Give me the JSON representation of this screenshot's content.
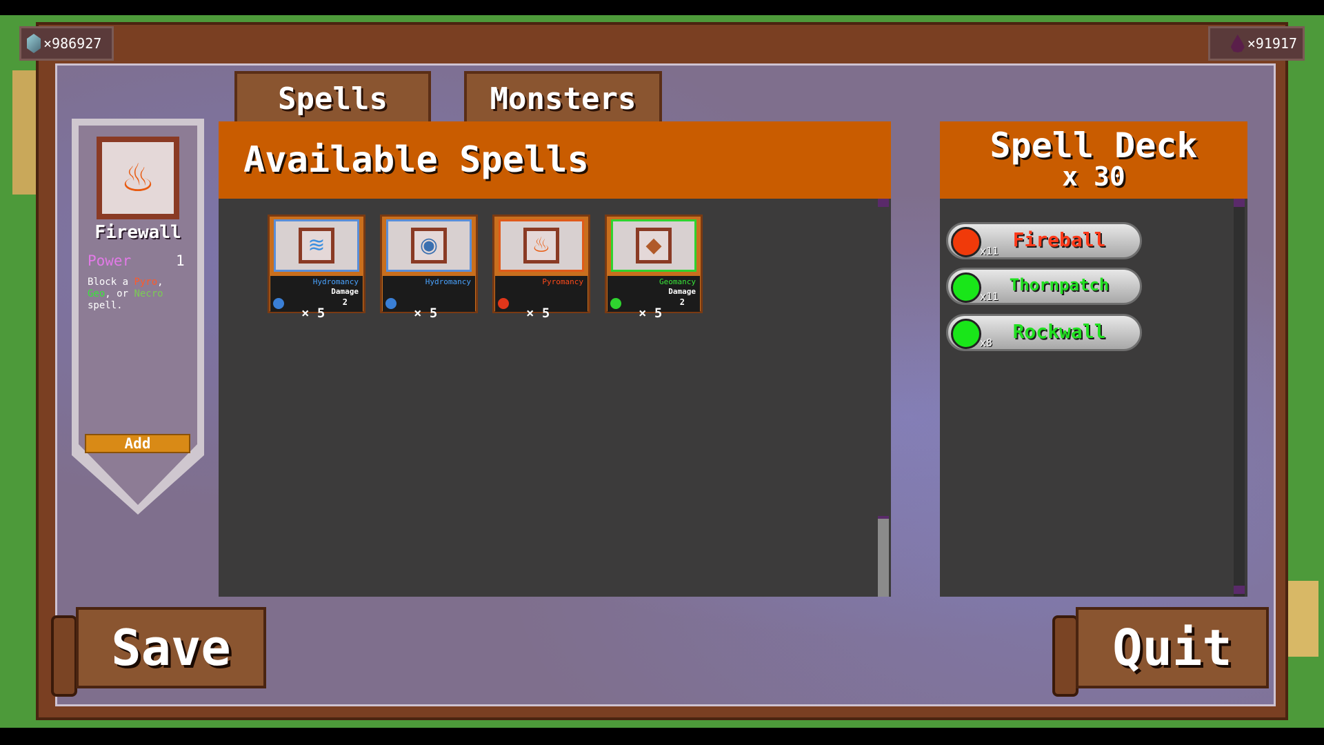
{
  "currency": {
    "crystals": "×986927",
    "essence": "×91917",
    "crystal_icon": "crystal-icon",
    "essence_icon": "essence-drop-icon"
  },
  "tabs": [
    {
      "label": "Spells",
      "active": true
    },
    {
      "label": "Monsters",
      "active": false
    }
  ],
  "available": {
    "title": "Available Spells",
    "cards": [
      {
        "school": "Hydromancy",
        "school_color": "#4aa3ff",
        "stat_label": "Damage",
        "stat_value": "2",
        "dot_color": "#3a7fd6",
        "count": "× 5",
        "art": "water-jet",
        "art_glyph": "≋"
      },
      {
        "school": "Hydromancy",
        "school_color": "#4aa3ff",
        "stat_label": "",
        "stat_value": "",
        "dot_color": "#3a7fd6",
        "count": "× 5",
        "art": "water-shield",
        "art_glyph": "◉"
      },
      {
        "school": "Pyromancy",
        "school_color": "#ff4a1a",
        "stat_label": "",
        "stat_value": "",
        "dot_color": "#e0361a",
        "count": "× 5",
        "art": "firewall",
        "art_glyph": "♨"
      },
      {
        "school": "Geomancy",
        "school_color": "#39e639",
        "stat_label": "Damage",
        "stat_value": "2",
        "dot_color": "#2fd32f",
        "count": "× 5",
        "art": "rock-shard",
        "art_glyph": "◆"
      }
    ]
  },
  "detail": {
    "name": "Firewall",
    "power_label": "Power",
    "power_value": "1",
    "desc_block": "Block a ",
    "desc_pyro": "Pyro",
    "desc_comma": ",",
    "desc_geo": "Geo",
    "desc_or": ", or ",
    "desc_necro": "Necro",
    "desc_end": "spell.",
    "add_label": "Add",
    "art_glyph": "♨"
  },
  "deck": {
    "title": "Spell Deck",
    "count": "x 30",
    "items": [
      {
        "name": "Fireball",
        "mult": "x11",
        "color": "#f03a0a",
        "text_color": "#ff3a1a"
      },
      {
        "name": "Thornpatch",
        "mult": "x11",
        "color": "#19e619",
        "text_color": "#21e021"
      },
      {
        "name": "Rockwall",
        "mult": "x8",
        "color": "#19e619",
        "text_color": "#21e021"
      }
    ]
  },
  "buttons": {
    "save": "Save",
    "quit": "Quit"
  }
}
